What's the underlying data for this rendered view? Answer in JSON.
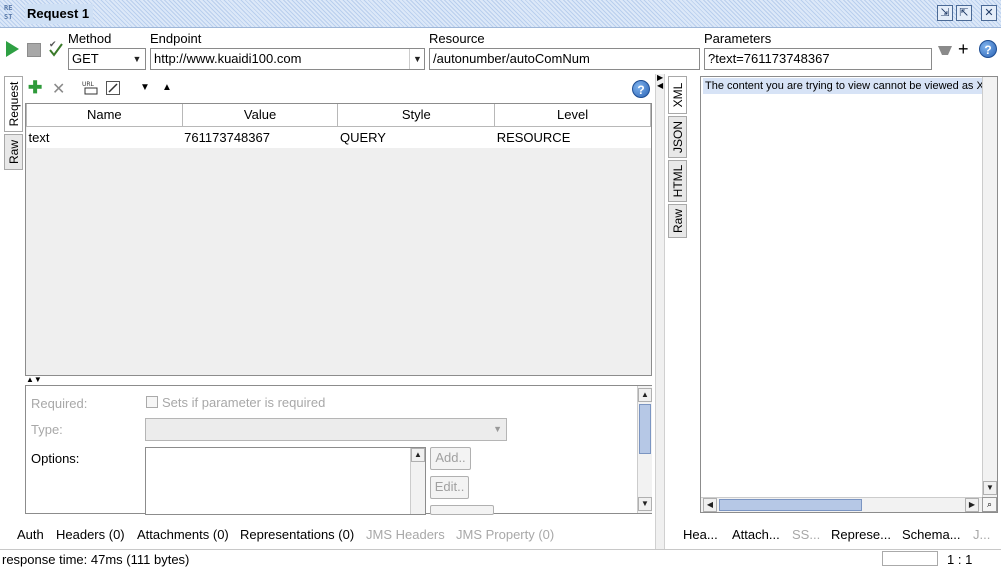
{
  "window": {
    "title": "Request 1",
    "icon_text": "RE ST"
  },
  "toolbar": {
    "method_label": "Method",
    "method_value": "GET",
    "endpoint_label": "Endpoint",
    "endpoint_value": "http://www.kuaidi100.com",
    "resource_label": "Resource",
    "resource_value": "/autonumber/autoComNum",
    "parameters_label": "Parameters",
    "parameters_value": "?text=761173748367",
    "plus": "+"
  },
  "left_tabs": {
    "request": "Request",
    "raw": "Raw"
  },
  "param_toolbar": {
    "add": "✚",
    "remove": "✕"
  },
  "table": {
    "headers": [
      "Name",
      "Value",
      "Style",
      "Level"
    ],
    "rows": [
      {
        "name": "text",
        "value": "761173748367",
        "style": "QUERY",
        "level": "RESOURCE"
      }
    ]
  },
  "detail": {
    "required_label": "Required:",
    "required_check_text": "Sets if parameter is required",
    "type_label": "Type:",
    "options_label": "Options:",
    "add_button": "Add..",
    "edit_button": "Edit.."
  },
  "bottom_tabs_left": [
    {
      "label": "Auth",
      "enabled": true
    },
    {
      "label": "Headers (0)",
      "enabled": true
    },
    {
      "label": "Attachments (0)",
      "enabled": true
    },
    {
      "label": "Representations (0)",
      "enabled": true
    },
    {
      "label": "JMS Headers",
      "enabled": false
    },
    {
      "label": "JMS Property (0)",
      "enabled": false
    }
  ],
  "right_tabs": {
    "xml": "XML",
    "json": "JSON",
    "html": "HTML",
    "raw": "Raw"
  },
  "response": {
    "message": "The content you are trying to view cannot be viewed as XML"
  },
  "bottom_tabs_right": [
    {
      "label": "Hea...",
      "enabled": true
    },
    {
      "label": "Attach...",
      "enabled": true
    },
    {
      "label": "SS...",
      "enabled": false
    },
    {
      "label": "Represe...",
      "enabled": true
    },
    {
      "label": "Schema...",
      "enabled": true
    },
    {
      "label": "J...",
      "enabled": false
    }
  ],
  "status": {
    "text": "response time: 47ms (111 bytes)",
    "position": "1 : 1"
  }
}
